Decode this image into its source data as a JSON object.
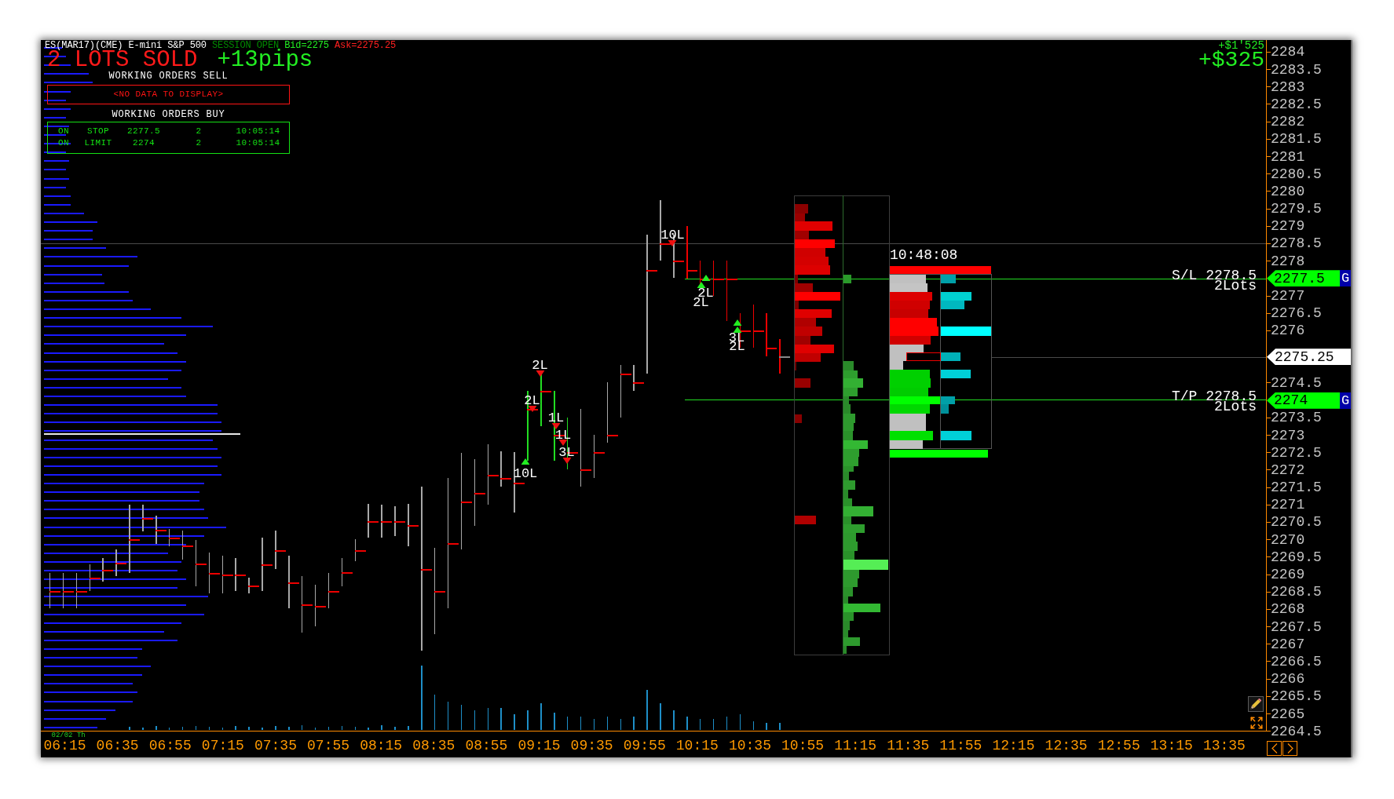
{
  "instrument": {
    "symbol": "ES(MAR17)(CME) E-mini S&P 500",
    "session": "SESSION OPEN",
    "bid": "Bid=2275",
    "ask": "Ask=2275.25"
  },
  "position": {
    "status": "2 LOTS SOLD",
    "pips": "+13pips"
  },
  "pnl": {
    "total": "+$1'525",
    "open": "+$325"
  },
  "working_orders": [
    {
      "title": "WORKING ORDERS SELL",
      "kind": "sell",
      "empty_text": "<NO DATA TO DISPLAY>"
    },
    {
      "title": "WORKING ORDERS BUY",
      "kind": "buy",
      "rows": [
        {
          "status": "ON",
          "type": "STOP",
          "price": "2277.5",
          "qty": "2",
          "time": "10:05:14"
        },
        {
          "status": "ON",
          "type": "LIMIT",
          "price": "2274",
          "qty": "2",
          "time": "10:05:14"
        }
      ]
    }
  ],
  "trades": [
    {
      "kind": "buy",
      "label": "10L"
    },
    {
      "kind": "sell",
      "label": "2L"
    },
    {
      "kind": "sell",
      "label": "2L"
    },
    {
      "kind": "sell",
      "label": "1L"
    },
    {
      "kind": "sell",
      "label": "1L"
    },
    {
      "kind": "sell",
      "label": "3L"
    },
    {
      "kind": "sell",
      "label": "10L"
    },
    {
      "kind": "buy",
      "label": "2L"
    },
    {
      "kind": "buy",
      "label": "2L"
    },
    {
      "kind": "buy",
      "label": "3L"
    },
    {
      "kind": "buy",
      "label": "2L"
    }
  ],
  "order_lines": [
    {
      "label": "S/L 2278.5",
      "lots": "2Lots"
    },
    {
      "label": "T/P 2278.5",
      "lots": "2Lots"
    }
  ],
  "ladder": {
    "time": "10:48:08"
  },
  "price_axis": [
    {
      "kind": "tick",
      "text": "2284"
    },
    {
      "kind": "tick",
      "text": "2283.5"
    },
    {
      "kind": "tick",
      "text": "2283"
    },
    {
      "kind": "tick",
      "text": "2282.5"
    },
    {
      "kind": "tick",
      "text": "2282"
    },
    {
      "kind": "tick",
      "text": "2281.5"
    },
    {
      "kind": "tick",
      "text": "2281"
    },
    {
      "kind": "tick",
      "text": "2280.5"
    },
    {
      "kind": "tick",
      "text": "2280"
    },
    {
      "kind": "tick",
      "text": "2279.5"
    },
    {
      "kind": "tick",
      "text": "2279"
    },
    {
      "kind": "tick",
      "text": "2278.5"
    },
    {
      "kind": "tick",
      "text": "2278"
    },
    {
      "kind": "order",
      "text": "2277.5",
      "badge": "G"
    },
    {
      "kind": "tick",
      "text": "2277"
    },
    {
      "kind": "tick",
      "text": "2276.5"
    },
    {
      "kind": "tick",
      "text": "2276"
    },
    {
      "kind": "last",
      "text": "2275.25"
    },
    {
      "kind": "tick",
      "text": "2274.5"
    },
    {
      "kind": "order",
      "text": "2274",
      "badge": "G"
    },
    {
      "kind": "tick",
      "text": "2273.5"
    },
    {
      "kind": "tick",
      "text": "2273"
    },
    {
      "kind": "tick",
      "text": "2272.5"
    },
    {
      "kind": "tick",
      "text": "2272"
    },
    {
      "kind": "tick",
      "text": "2271.5"
    },
    {
      "kind": "tick",
      "text": "2271"
    },
    {
      "kind": "tick",
      "text": "2270.5"
    },
    {
      "kind": "tick",
      "text": "2270"
    },
    {
      "kind": "tick",
      "text": "2269.5"
    },
    {
      "kind": "tick",
      "text": "2269"
    },
    {
      "kind": "tick",
      "text": "2268.5"
    },
    {
      "kind": "tick",
      "text": "2268"
    },
    {
      "kind": "tick",
      "text": "2267.5"
    },
    {
      "kind": "tick",
      "text": "2267"
    },
    {
      "kind": "tick",
      "text": "2266.5"
    },
    {
      "kind": "tick",
      "text": "2266"
    },
    {
      "kind": "tick",
      "text": "2265.5"
    },
    {
      "kind": "tick",
      "text": "2265"
    },
    {
      "kind": "tick",
      "text": "2264.5"
    }
  ],
  "time_axis": {
    "date": "02/02 Th",
    "labels": [
      "06:15",
      "06:35",
      "06:55",
      "07:15",
      "07:35",
      "07:55",
      "08:15",
      "08:35",
      "08:55",
      "09:15",
      "09:35",
      "09:55",
      "10:15",
      "10:35",
      "10:55",
      "11:15",
      "11:35",
      "11:55",
      "12:15",
      "12:35",
      "12:55",
      "13:15",
      "13:35"
    ]
  }
}
